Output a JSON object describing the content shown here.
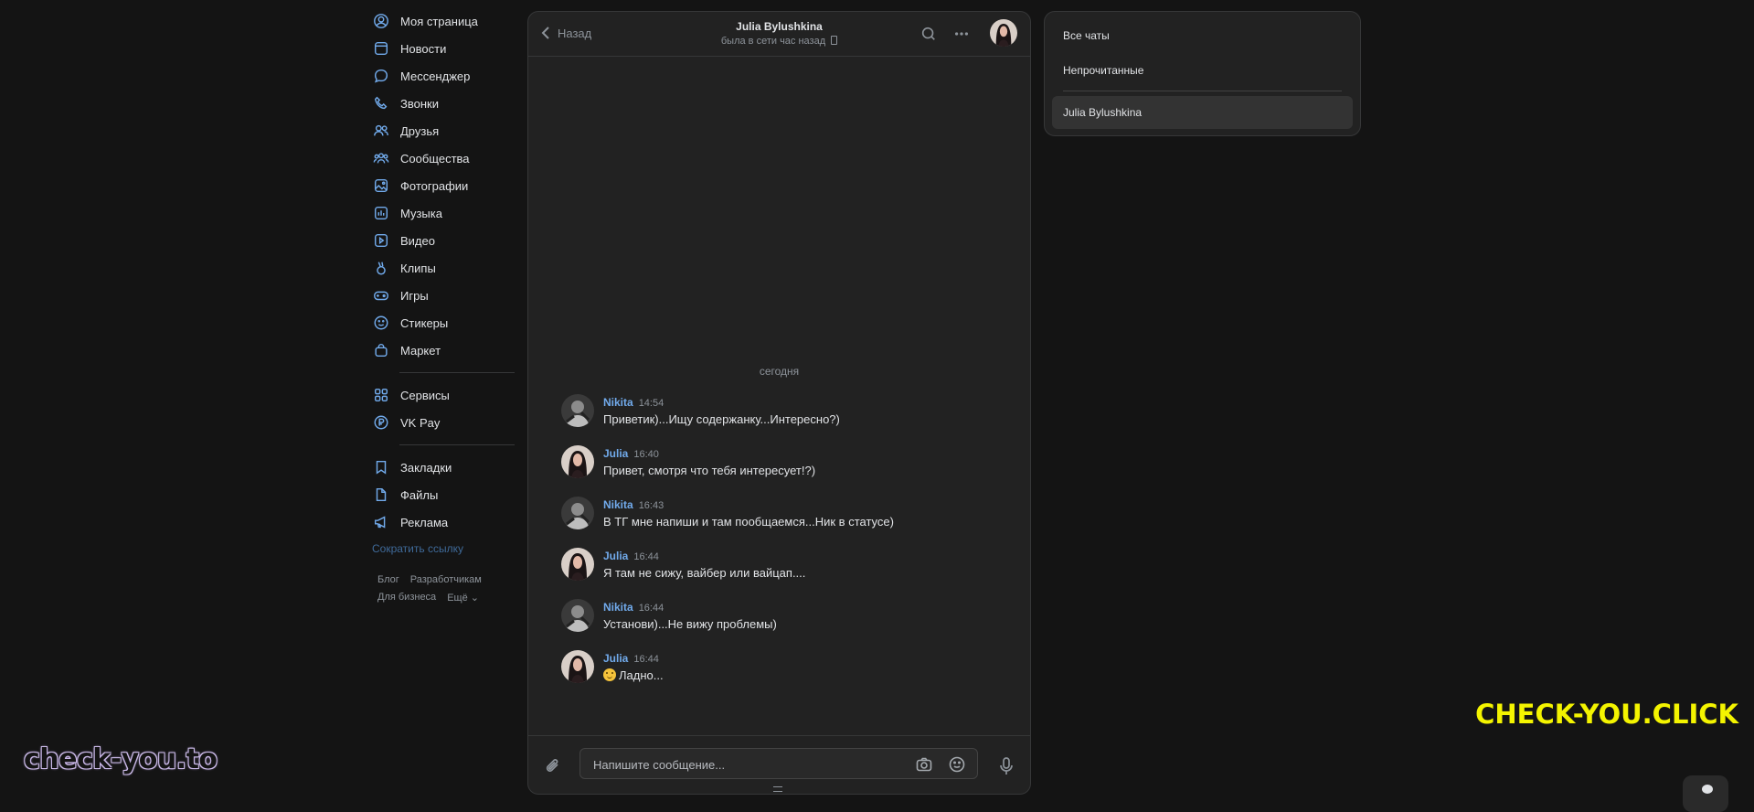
{
  "sidebar": {
    "items": [
      {
        "label": "Моя страница",
        "icon": "user-circle-icon"
      },
      {
        "label": "Новости",
        "icon": "newspaper-icon"
      },
      {
        "label": "Мессенджер",
        "icon": "message-bubble-icon"
      },
      {
        "label": "Звонки",
        "icon": "phone-icon"
      },
      {
        "label": "Друзья",
        "icon": "friends-icon"
      },
      {
        "label": "Сообщества",
        "icon": "communities-icon"
      },
      {
        "label": "Фотографии",
        "icon": "picture-icon"
      },
      {
        "label": "Музыка",
        "icon": "music-icon"
      },
      {
        "label": "Видео",
        "icon": "video-icon"
      },
      {
        "label": "Клипы",
        "icon": "clips-icon"
      },
      {
        "label": "Игры",
        "icon": "gamepad-icon"
      },
      {
        "label": "Стикеры",
        "icon": "smile-icon"
      },
      {
        "label": "Маркет",
        "icon": "shopping-bag-icon"
      }
    ],
    "items2": [
      {
        "label": "Сервисы",
        "icon": "services-grid-icon"
      },
      {
        "label": "VK Pay",
        "icon": "vk-pay-icon"
      }
    ],
    "items3": [
      {
        "label": "Закладки",
        "icon": "bookmark-icon"
      },
      {
        "label": "Файлы",
        "icon": "file-icon"
      },
      {
        "label": "Реклама",
        "icon": "megaphone-icon"
      }
    ],
    "shorten_link": "Сократить ссылку",
    "footer": {
      "blog": "Блог",
      "developers": "Разработчикам",
      "business": "Для бизнеса",
      "more": "Ещё"
    }
  },
  "chat": {
    "back_label": "Назад",
    "peer_name": "Julia Bylushkina",
    "peer_status": "была в сети час назад",
    "day_label": "сегодня",
    "messages": [
      {
        "author": "Nikita",
        "time": "14:54",
        "text": "Приветик)...Ищу содержанку...Интересно?)"
      },
      {
        "author": "Julia",
        "time": "16:40",
        "text": "Привет, смотря что тебя интересует!?)"
      },
      {
        "author": "Nikita",
        "time": "16:43",
        "text": "В ТГ мне напиши и там пообщаемся...Ник в статусе)"
      },
      {
        "author": "Julia",
        "time": "16:44",
        "text": "Я там не сижу, вайбер или вайцап...."
      },
      {
        "author": "Nikita",
        "time": "16:44",
        "text": "Установи)...Не вижу проблемы)"
      },
      {
        "author": "Julia",
        "time": "16:44",
        "text": "Ладно..."
      }
    ],
    "composer_placeholder": "Напишите сообщение..."
  },
  "filters": {
    "all_chats": "Все чаты",
    "unread": "Непрочитанные",
    "active_chat": "Julia Bylushkina"
  },
  "watermarks": {
    "left": "check-you.to",
    "right": "CHECK-YOU.CLICK"
  },
  "colors": {
    "accent": "#71aaeb",
    "background": "#141414",
    "panel": "#222222",
    "watermark_yellow": "#f4f400"
  }
}
